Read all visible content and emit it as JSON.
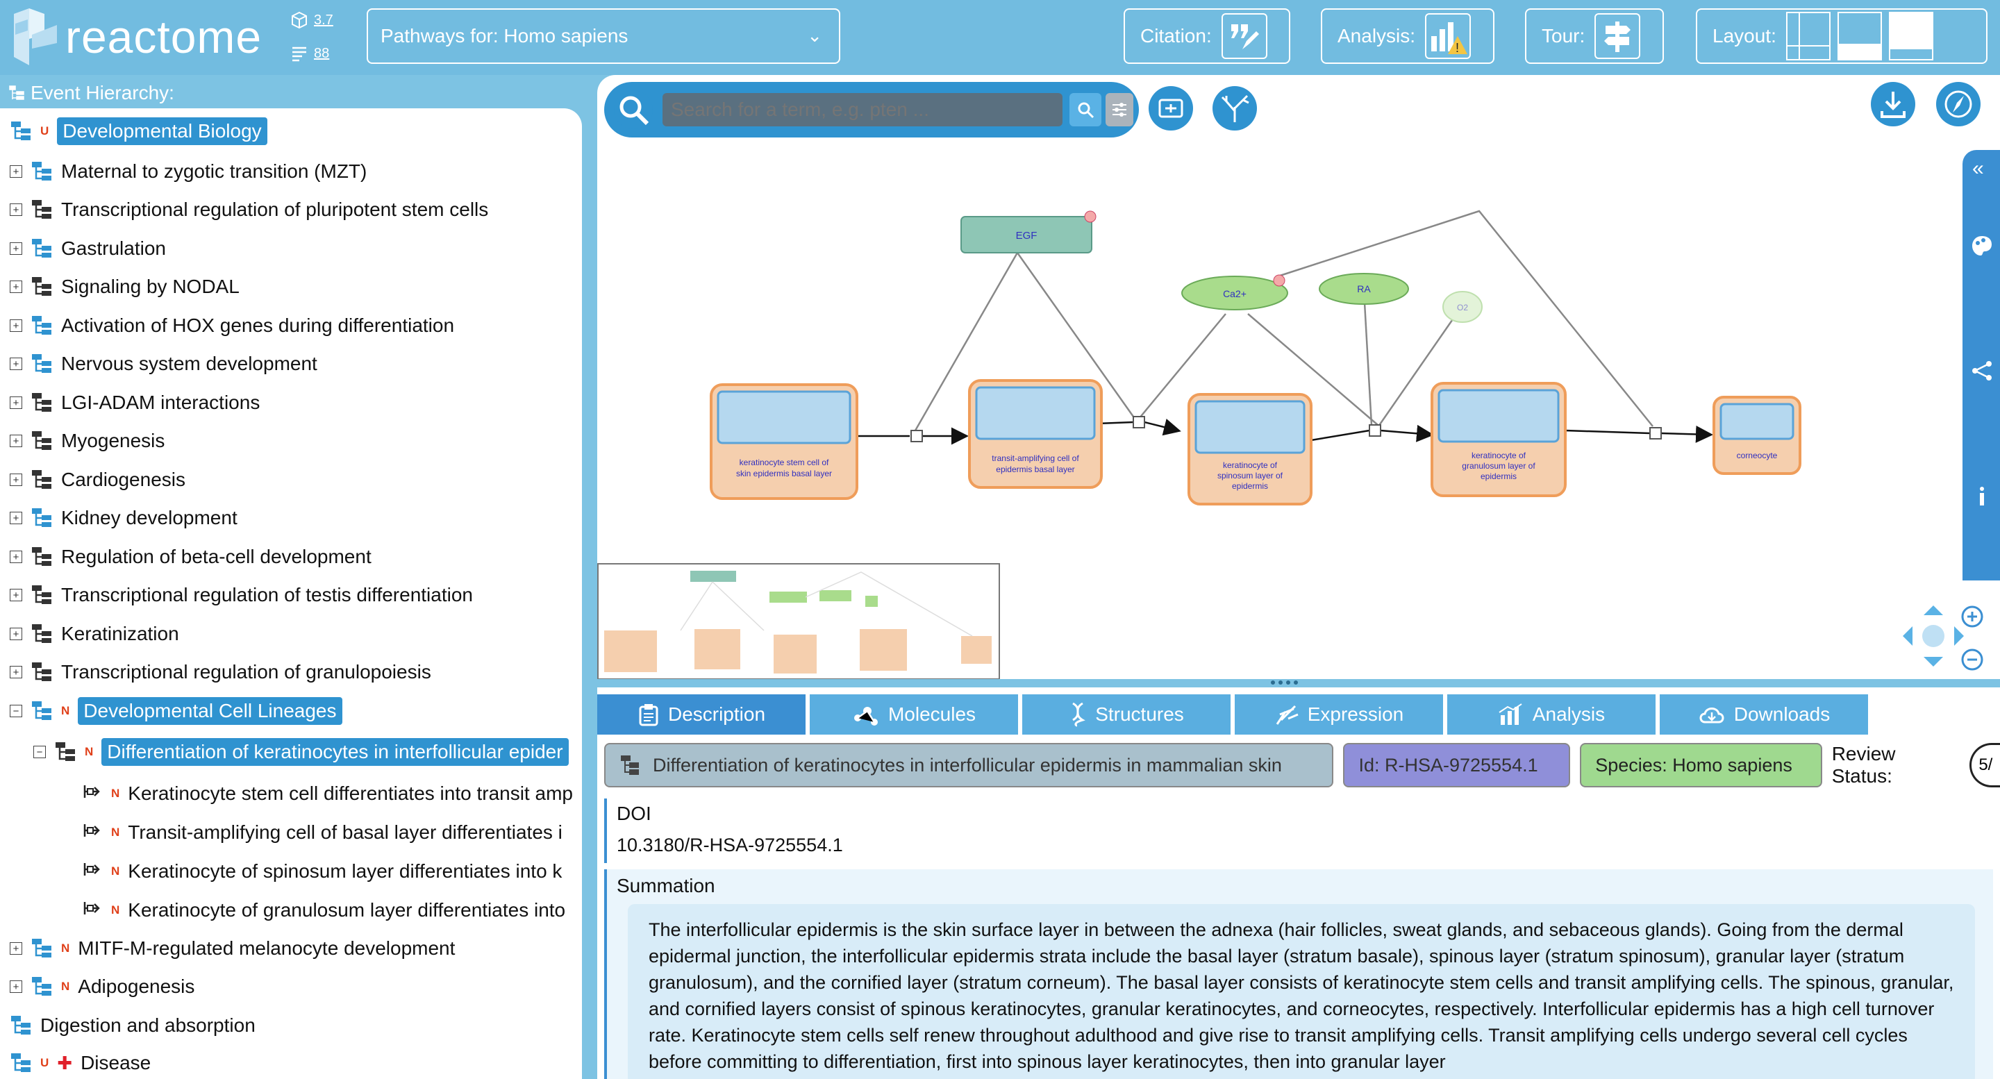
{
  "app": {
    "logo_text": "reactome",
    "version": "3.7",
    "release_count": "88"
  },
  "topbar": {
    "species_label": "Pathways for:  Homo sapiens",
    "citation_label": "Citation:",
    "analysis_label": "Analysis:",
    "tour_label": "Tour:",
    "layout_label": "Layout:"
  },
  "sidebar": {
    "title": "Event Hierarchy:",
    "items": [
      {
        "label": "Developmental Biology",
        "badge": "U"
      },
      {
        "label": "Maternal to zygotic transition (MZT)"
      },
      {
        "label": "Transcriptional regulation of pluripotent stem cells"
      },
      {
        "label": "Gastrulation"
      },
      {
        "label": "Signaling by NODAL"
      },
      {
        "label": "Activation of HOX genes during differentiation"
      },
      {
        "label": "Nervous system development"
      },
      {
        "label": "LGI-ADAM interactions"
      },
      {
        "label": "Myogenesis"
      },
      {
        "label": "Cardiogenesis"
      },
      {
        "label": "Kidney development"
      },
      {
        "label": "Regulation of beta-cell development"
      },
      {
        "label": "Transcriptional regulation of testis differentiation"
      },
      {
        "label": "Keratinization"
      },
      {
        "label": "Transcriptional regulation of granulopoiesis"
      },
      {
        "label": "Developmental Cell Lineages",
        "badge": "N"
      },
      {
        "label": "Differentiation of keratinocytes in interfollicular epider",
        "badge": "N"
      },
      {
        "label": "Keratinocyte stem cell differentiates into transit amp",
        "badge": "N"
      },
      {
        "label": "Transit-amplifying cell of basal layer differentiates i",
        "badge": "N"
      },
      {
        "label": "Keratinocyte of spinosum layer differentiates into k",
        "badge": "N"
      },
      {
        "label": "Keratinocyte of granulosum layer differentiates into",
        "badge": "N"
      },
      {
        "label": "MITF-M-regulated melanocyte development",
        "badge": "N"
      },
      {
        "label": "Adipogenesis",
        "badge": "N"
      },
      {
        "label": "Digestion and absorption"
      },
      {
        "label": "Disease",
        "badge": "U"
      }
    ]
  },
  "diagram": {
    "search_placeholder": "Search for a term, e.g. pten ...",
    "nodes": {
      "egf": "EGF",
      "ca": "Ca2+",
      "ra": "RA",
      "o2": "O2",
      "cell1": "keratinocyte stem cell of skin epidermis basal layer",
      "cell2": "transit-amplifying cell of epidermis basal layer",
      "cell3": "keratinocyte of spinosum layer of epidermis",
      "cell4": "keratinocyte of granulosum layer of epidermis",
      "cell5": "corneocyte"
    }
  },
  "details": {
    "tabs": [
      "Description",
      "Molecules",
      "Structures",
      "Expression",
      "Analysis",
      "Downloads"
    ],
    "pathway_name": "Differentiation of keratinocytes in interfollicular epidermis in mammalian skin",
    "id_label": "Id: R-HSA-9725554.1",
    "species_label": "Species: Homo sapiens",
    "review_label": "Review Status:",
    "review_value": "5/",
    "doi_title": "DOI",
    "doi_value": "10.3180/R-HSA-9725554.1",
    "summation_title": "Summation",
    "summation_text": "The interfollicular epidermis is the skin surface layer in between the adnexa (hair follicles, sweat glands, and sebaceous glands). Going from the dermal epidermal junction, the interfollicular epidermis strata include the basal layer (stratum basale), spinous layer (stratum spinosum), granular layer (stratum granulosum), and the cornified layer (stratum corneum). The basal layer consists of keratinocyte stem cells and transit amplifying cells. The spinous, granular, and cornified layers consist of spinous keratinocytes, granular keratinocytes, and corneocytes, respectively. Interfollicular epidermis has a high cell turnover rate. Keratinocyte stem cells self renew throughout adulthood and give rise to transit amplifying cells. Transit amplifying cells undergo several cell cycles before committing to differentiation, first into spinous layer keratinocytes, then into granular layer"
  },
  "colors": {
    "topbar": "#72bce0",
    "accent": "#2f93d0",
    "cell_fill": "#f5cfae",
    "cell_border": "#ef9d5a",
    "molecule_green": "#a9dc8c",
    "egf_fill": "#8ec6b5",
    "id_pill": "#8f8fd9",
    "species_pill": "#9fd98f"
  }
}
